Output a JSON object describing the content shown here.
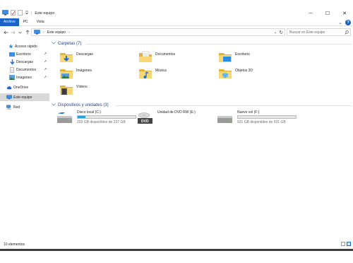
{
  "window": {
    "title": "Este equipo",
    "controls": {
      "minimize": "—",
      "maximize": "☐",
      "close": "✕"
    }
  },
  "ribbon": {
    "tabs": [
      {
        "label": "Archivo",
        "active": true
      },
      {
        "label": "PC",
        "active": false
      },
      {
        "label": "Vista",
        "active": false
      }
    ],
    "collapse_glyph": "⌄",
    "help_glyph": "?"
  },
  "nav": {
    "address_path": "Este equipo",
    "address_sep": "›",
    "address_chevron": "›",
    "dropdown_glyph": "⌄",
    "refresh_glyph": "↻",
    "search_placeholder": "Buscar en Este equipo"
  },
  "sidebar": {
    "items": [
      {
        "label": "Acceso rápido",
        "icon": "star-icon",
        "pinned": false
      },
      {
        "label": "Escritorio",
        "icon": "desktop-icon",
        "pinned": true
      },
      {
        "label": "Descargas",
        "icon": "download-icon",
        "pinned": true
      },
      {
        "label": "Documentos",
        "icon": "documents-icon",
        "pinned": true
      },
      {
        "label": "Imágenes",
        "icon": "pictures-icon",
        "pinned": true
      },
      {
        "label": "OneDrive",
        "icon": "cloud-icon",
        "pinned": false
      },
      {
        "label": "Este equipo",
        "icon": "computer-icon",
        "pinned": false,
        "selected": true
      },
      {
        "label": "Red",
        "icon": "network-icon",
        "pinned": false
      }
    ]
  },
  "folders_group": {
    "header": "Carpetas (7)",
    "items": [
      {
        "label": "Descargas",
        "icon": "downloads-folder-icon"
      },
      {
        "label": "Documentos",
        "icon": "documents-folder-icon"
      },
      {
        "label": "Escritorio",
        "icon": "desktop-folder-icon"
      },
      {
        "label": "Imágenes",
        "icon": "pictures-folder-icon"
      },
      {
        "label": "Música",
        "icon": "music-folder-icon"
      },
      {
        "label": "Objetos 3D",
        "icon": "objects-3d-folder-icon"
      },
      {
        "label": "Vídeos",
        "icon": "videos-folder-icon"
      }
    ]
  },
  "devices_group": {
    "header": "Dispositivos y unidades (3)",
    "items": [
      {
        "label": "Disco local (C:)",
        "detail": "203 GB disponibles de 237 GB",
        "used_fraction": 0.14,
        "icon": "hard-drive-icon"
      },
      {
        "label": "Unidad de DVD RW (E:)",
        "detail": "",
        "icon": "dvd-drive-icon",
        "icon_text": "DVD"
      },
      {
        "label": "Nuevo vol (F:)",
        "detail": "931 GB disponibles de 931 GB",
        "used_fraction": 0.0,
        "icon": "external-drive-icon"
      }
    ]
  },
  "status": {
    "item_count": "10 elementos"
  },
  "colors": {
    "accent": "#1a64c8",
    "folder_yellow": "#f8d775",
    "folder_dark": "#e2b33c",
    "drive_fill": "#26a0da",
    "group_header": "#1e3f8a"
  }
}
